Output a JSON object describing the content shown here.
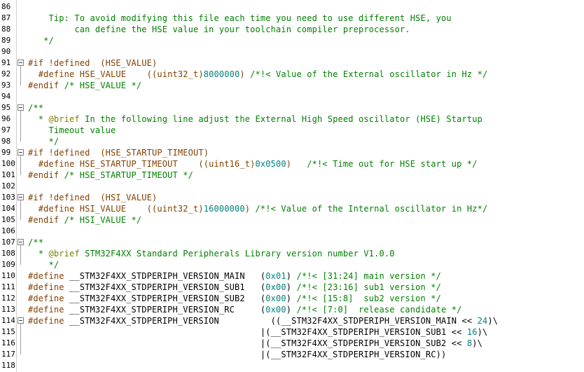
{
  "colors": {
    "comment": "#008000",
    "preprocessor": "#804000",
    "number": "#008080",
    "text": "#000000",
    "doc_tag": "#808000"
  },
  "lines": [
    {
      "n": "86",
      "tokens": []
    },
    {
      "n": "87",
      "tokens": [
        {
          "t": "    Tip: To avoid modifying this file each time you need to use different HSE, you",
          "c": "comment"
        }
      ]
    },
    {
      "n": "88",
      "tokens": [
        {
          "t": "         can define the HSE value in your toolchain compiler preprocessor.",
          "c": "comment"
        }
      ]
    },
    {
      "n": "89",
      "tokens": [
        {
          "t": "   */",
          "c": "comment"
        }
      ]
    },
    {
      "n": "90",
      "tokens": []
    },
    {
      "n": "91",
      "fold": true,
      "tokens": [
        {
          "t": "#if !defined  (HSE_VALUE)",
          "c": "pre"
        }
      ]
    },
    {
      "n": "92",
      "tokens": [
        {
          "t": "  #define HSE_VALUE    ((uint32_t)",
          "c": "pre"
        },
        {
          "t": "8000000",
          "c": "num"
        },
        {
          "t": ") ",
          "c": "pre"
        },
        {
          "t": "/*!< Value of the External oscillator in Hz */",
          "c": "comment"
        }
      ]
    },
    {
      "n": "93",
      "tokens": [
        {
          "t": "#endif ",
          "c": "pre"
        },
        {
          "t": "/* HSE_VALUE */",
          "c": "comment"
        }
      ]
    },
    {
      "n": "94",
      "tokens": []
    },
    {
      "n": "95",
      "fold": true,
      "tokens": [
        {
          "t": "/**",
          "c": "comment"
        }
      ]
    },
    {
      "n": "96",
      "tokens": [
        {
          "t": "  * ",
          "c": "comment"
        },
        {
          "t": "@brief",
          "c": "doc"
        },
        {
          "t": " In the following line adjust the External High Speed oscillator (HSE) Startup",
          "c": "comment"
        }
      ]
    },
    {
      "n": "97",
      "tokens": [
        {
          "t": "    Timeout value",
          "c": "comment"
        }
      ]
    },
    {
      "n": "98",
      "tokens": [
        {
          "t": "    */",
          "c": "comment"
        }
      ]
    },
    {
      "n": "99",
      "fold": true,
      "tokens": [
        {
          "t": "#if !defined  (HSE_STARTUP_TIMEOUT)",
          "c": "pre"
        }
      ]
    },
    {
      "n": "100",
      "tokens": [
        {
          "t": "  #define HSE_STARTUP_TIMEOUT    ((uint16_t)",
          "c": "pre"
        },
        {
          "t": "0x0500",
          "c": "num"
        },
        {
          "t": ")   ",
          "c": "pre"
        },
        {
          "t": "/*!< Time out for HSE start up */",
          "c": "comment"
        }
      ]
    },
    {
      "n": "101",
      "tokens": [
        {
          "t": "#endif ",
          "c": "pre"
        },
        {
          "t": "/* HSE_STARTUP_TIMEOUT */",
          "c": "comment"
        }
      ]
    },
    {
      "n": "102",
      "tokens": []
    },
    {
      "n": "103",
      "fold": true,
      "tokens": [
        {
          "t": "#if !defined  (HSI_VALUE)",
          "c": "pre"
        }
      ]
    },
    {
      "n": "104",
      "tokens": [
        {
          "t": "  #define HSI_VALUE    ((uint32_t)",
          "c": "pre"
        },
        {
          "t": "16000000",
          "c": "num"
        },
        {
          "t": ") ",
          "c": "pre"
        },
        {
          "t": "/*!< Value of the Internal oscillator in Hz*/",
          "c": "comment"
        }
      ]
    },
    {
      "n": "105",
      "tokens": [
        {
          "t": "#endif ",
          "c": "pre"
        },
        {
          "t": "/* HSI_VALUE */",
          "c": "comment"
        }
      ]
    },
    {
      "n": "106",
      "tokens": []
    },
    {
      "n": "107",
      "fold": true,
      "tokens": [
        {
          "t": "/**",
          "c": "comment"
        }
      ]
    },
    {
      "n": "108",
      "tokens": [
        {
          "t": "  * ",
          "c": "comment"
        },
        {
          "t": "@brief",
          "c": "doc"
        },
        {
          "t": " STM32F4XX Standard Peripherals Library version number V1.0.0",
          "c": "comment"
        }
      ]
    },
    {
      "n": "109",
      "tokens": [
        {
          "t": "    */",
          "c": "comment"
        }
      ]
    },
    {
      "n": "110",
      "tokens": [
        {
          "t": "#define ",
          "c": "pre"
        },
        {
          "t": "__STM32F4XX_STDPERIPH_VERSION_MAIN   (",
          "c": "plain"
        },
        {
          "t": "0x01",
          "c": "num"
        },
        {
          "t": ") ",
          "c": "plain"
        },
        {
          "t": "/*!< [31:24] main version */",
          "c": "comment"
        }
      ]
    },
    {
      "n": "111",
      "tokens": [
        {
          "t": "#define ",
          "c": "pre"
        },
        {
          "t": "__STM32F4XX_STDPERIPH_VERSION_SUB1   (",
          "c": "plain"
        },
        {
          "t": "0x00",
          "c": "num"
        },
        {
          "t": ") ",
          "c": "plain"
        },
        {
          "t": "/*!< [23:16] sub1 version */",
          "c": "comment"
        }
      ]
    },
    {
      "n": "112",
      "tokens": [
        {
          "t": "#define ",
          "c": "pre"
        },
        {
          "t": "__STM32F4XX_STDPERIPH_VERSION_SUB2   (",
          "c": "plain"
        },
        {
          "t": "0x00",
          "c": "num"
        },
        {
          "t": ") ",
          "c": "plain"
        },
        {
          "t": "/*!< [15:8]  sub2 version */",
          "c": "comment"
        }
      ]
    },
    {
      "n": "113",
      "tokens": [
        {
          "t": "#define ",
          "c": "pre"
        },
        {
          "t": "__STM32F4XX_STDPERIPH_VERSION_RC     (",
          "c": "plain"
        },
        {
          "t": "0x00",
          "c": "num"
        },
        {
          "t": ") ",
          "c": "plain"
        },
        {
          "t": "/*!< [7:0]  release candidate */",
          "c": "comment"
        }
      ]
    },
    {
      "n": "114",
      "fold": true,
      "tokens": [
        {
          "t": "#define ",
          "c": "pre"
        },
        {
          "t": "__STM32F4XX_STDPERIPH_VERSION          ((__STM32F4XX_STDPERIPH_VERSION_MAIN << ",
          "c": "plain"
        },
        {
          "t": "24",
          "c": "num"
        },
        {
          "t": ")\\",
          "c": "plain"
        }
      ]
    },
    {
      "n": "115",
      "tokens": [
        {
          "t": "                                             |(__STM32F4XX_STDPERIPH_VERSION_SUB1 << ",
          "c": "plain"
        },
        {
          "t": "16",
          "c": "num"
        },
        {
          "t": ")\\",
          "c": "plain"
        }
      ]
    },
    {
      "n": "116",
      "tokens": [
        {
          "t": "                                             |(__STM32F4XX_STDPERIPH_VERSION_SUB2 << ",
          "c": "plain"
        },
        {
          "t": "8",
          "c": "num"
        },
        {
          "t": ")\\",
          "c": "plain"
        }
      ]
    },
    {
      "n": "117",
      "tokens": [
        {
          "t": "                                             |(__STM32F4XX_STDPERIPH_VERSION_RC))",
          "c": "plain"
        }
      ]
    },
    {
      "n": "118",
      "tokens": []
    }
  ]
}
